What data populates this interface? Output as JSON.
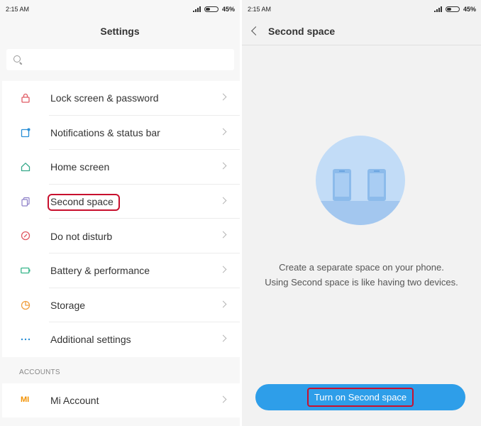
{
  "status_bar": {
    "time": "2:15 AM",
    "battery": "45%"
  },
  "settings": {
    "title": "Settings",
    "search": {
      "placeholder": ""
    },
    "items": [
      {
        "label": "Lock screen & password",
        "icon": "lock-icon",
        "color": "#e05a63"
      },
      {
        "label": "Notifications & status bar",
        "icon": "notification-icon",
        "color": "#2a8fd6"
      },
      {
        "label": "Home screen",
        "icon": "home-icon",
        "color": "#36a88a"
      },
      {
        "label": "Second space",
        "icon": "second-space-icon",
        "color": "#8d7fc7"
      },
      {
        "label": "Do not disturb",
        "icon": "do-not-disturb-icon",
        "color": "#e05a63"
      },
      {
        "label": "Battery & performance",
        "icon": "battery-icon",
        "color": "#36b58a"
      },
      {
        "label": "Storage",
        "icon": "storage-icon",
        "color": "#f0a040"
      },
      {
        "label": "Additional settings",
        "icon": "more-icon",
        "color": "#2a8fd6"
      }
    ],
    "accounts_header": "ACCOUNTS",
    "mi_account": {
      "label": "Mi Account",
      "logo": "MI",
      "color": "#f29100"
    }
  },
  "second_space": {
    "title": "Second space",
    "description_line1": "Create a separate space on your phone.",
    "description_line2": "Using Second space is like having two devices.",
    "button_label": "Turn on Second space",
    "accent": "#2e9ee9"
  }
}
